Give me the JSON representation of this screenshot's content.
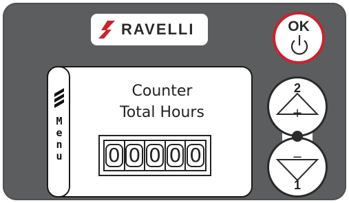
{
  "brand": {
    "name": "RAVELLI",
    "logo_icon": "ravelli-flame-logo"
  },
  "ok_button": {
    "label": "OK",
    "icon": "power-icon"
  },
  "display": {
    "menu_letters": [
      "M",
      "e",
      "n",
      "u"
    ],
    "title_line1": "Counter",
    "title_line2": "Total Hours",
    "digits": [
      "0",
      "0",
      "0",
      "0",
      "0"
    ]
  },
  "keypad": {
    "up": {
      "number": "2",
      "sign": "+"
    },
    "down": {
      "number": "1",
      "sign": "−"
    }
  },
  "colors": {
    "panel": "#5b5d5f",
    "accent_red": "#c8242d",
    "ink": "#222222"
  }
}
